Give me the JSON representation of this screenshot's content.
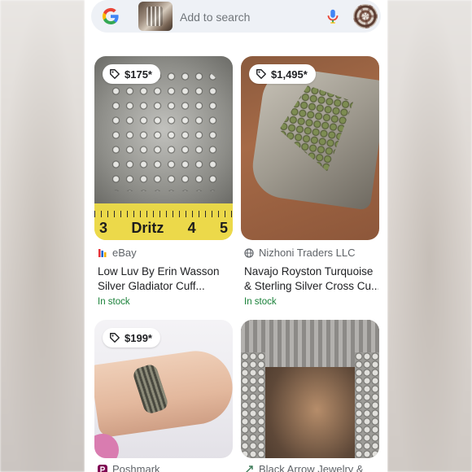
{
  "search": {
    "placeholder": "Add to search"
  },
  "icons": {
    "google": "google-logo-icon",
    "mic": "mic-icon",
    "tag": "price-tag-icon",
    "globe": "globe-icon"
  },
  "colors": {
    "in_stock": "#188038",
    "search_bg": "#eef1f6"
  },
  "results": [
    {
      "price": "$175*",
      "source": "eBay",
      "title_line1": "Low Luv By Erin Wasson",
      "title_line2": "Silver Gladiator Cuff...",
      "stock": "In stock",
      "ruler_numbers": [
        "3",
        "Dritz",
        "4",
        "5"
      ]
    },
    {
      "price": "$1,495*",
      "source": "Nizhoni Traders LLC",
      "title_line1": "Navajo Royston Turquoise",
      "title_line2": "& Sterling Silver Cross Cu...",
      "stock": "In stock"
    },
    {
      "price": "$199*",
      "source": "Poshmark"
    },
    {
      "source": "Black Arrow Jewelry &"
    }
  ]
}
